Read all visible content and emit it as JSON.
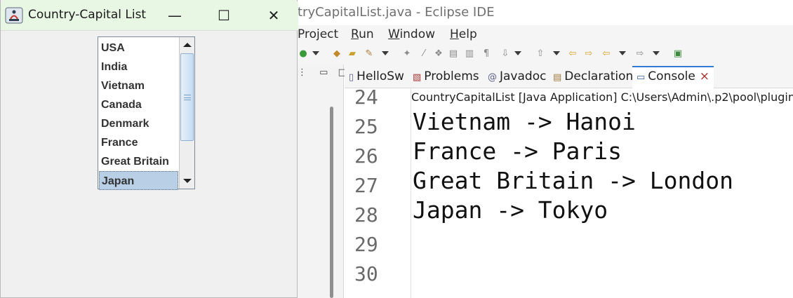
{
  "eclipse": {
    "title": "tryCapitalList.java - Eclipse IDE",
    "menu": [
      {
        "mnemonic": "",
        "rest": "Project"
      },
      {
        "mnemonic": "R",
        "rest": "un"
      },
      {
        "mnemonic": "W",
        "rest": "indow"
      },
      {
        "mnemonic": "H",
        "rest": "elp"
      }
    ],
    "tabs": {
      "editor": "HelloSw",
      "problems": "Problems",
      "javadoc": "Javadoc",
      "declaration": "Declaration",
      "console": "Console",
      "console_close": "×"
    },
    "line_numbers": [
      "24",
      "25",
      "26",
      "27",
      "28",
      "29",
      "30"
    ],
    "console": {
      "header": "CountryCapitalList [Java Application] C:\\Users\\Admin\\.p2\\pool\\plugin",
      "lines": [
        "Vietnam -> Hanoi",
        "France -> Paris",
        "Great Britain -> London",
        "Japan -> Tokyo"
      ]
    }
  },
  "swing": {
    "title": "Country-Capital List",
    "controls": {
      "minimize": "—",
      "maximize": "☐",
      "close": "✕"
    },
    "list_items": [
      "USA",
      "India",
      "Vietnam",
      "Canada",
      "Denmark",
      "France",
      "Great Britain",
      "Japan"
    ],
    "selected_item": "Japan"
  },
  "colors": {
    "swing_title_bg": "#e8f6e4",
    "selection_bg": "#b8cfe5",
    "console_tab_accent": "#2f7bd6"
  }
}
